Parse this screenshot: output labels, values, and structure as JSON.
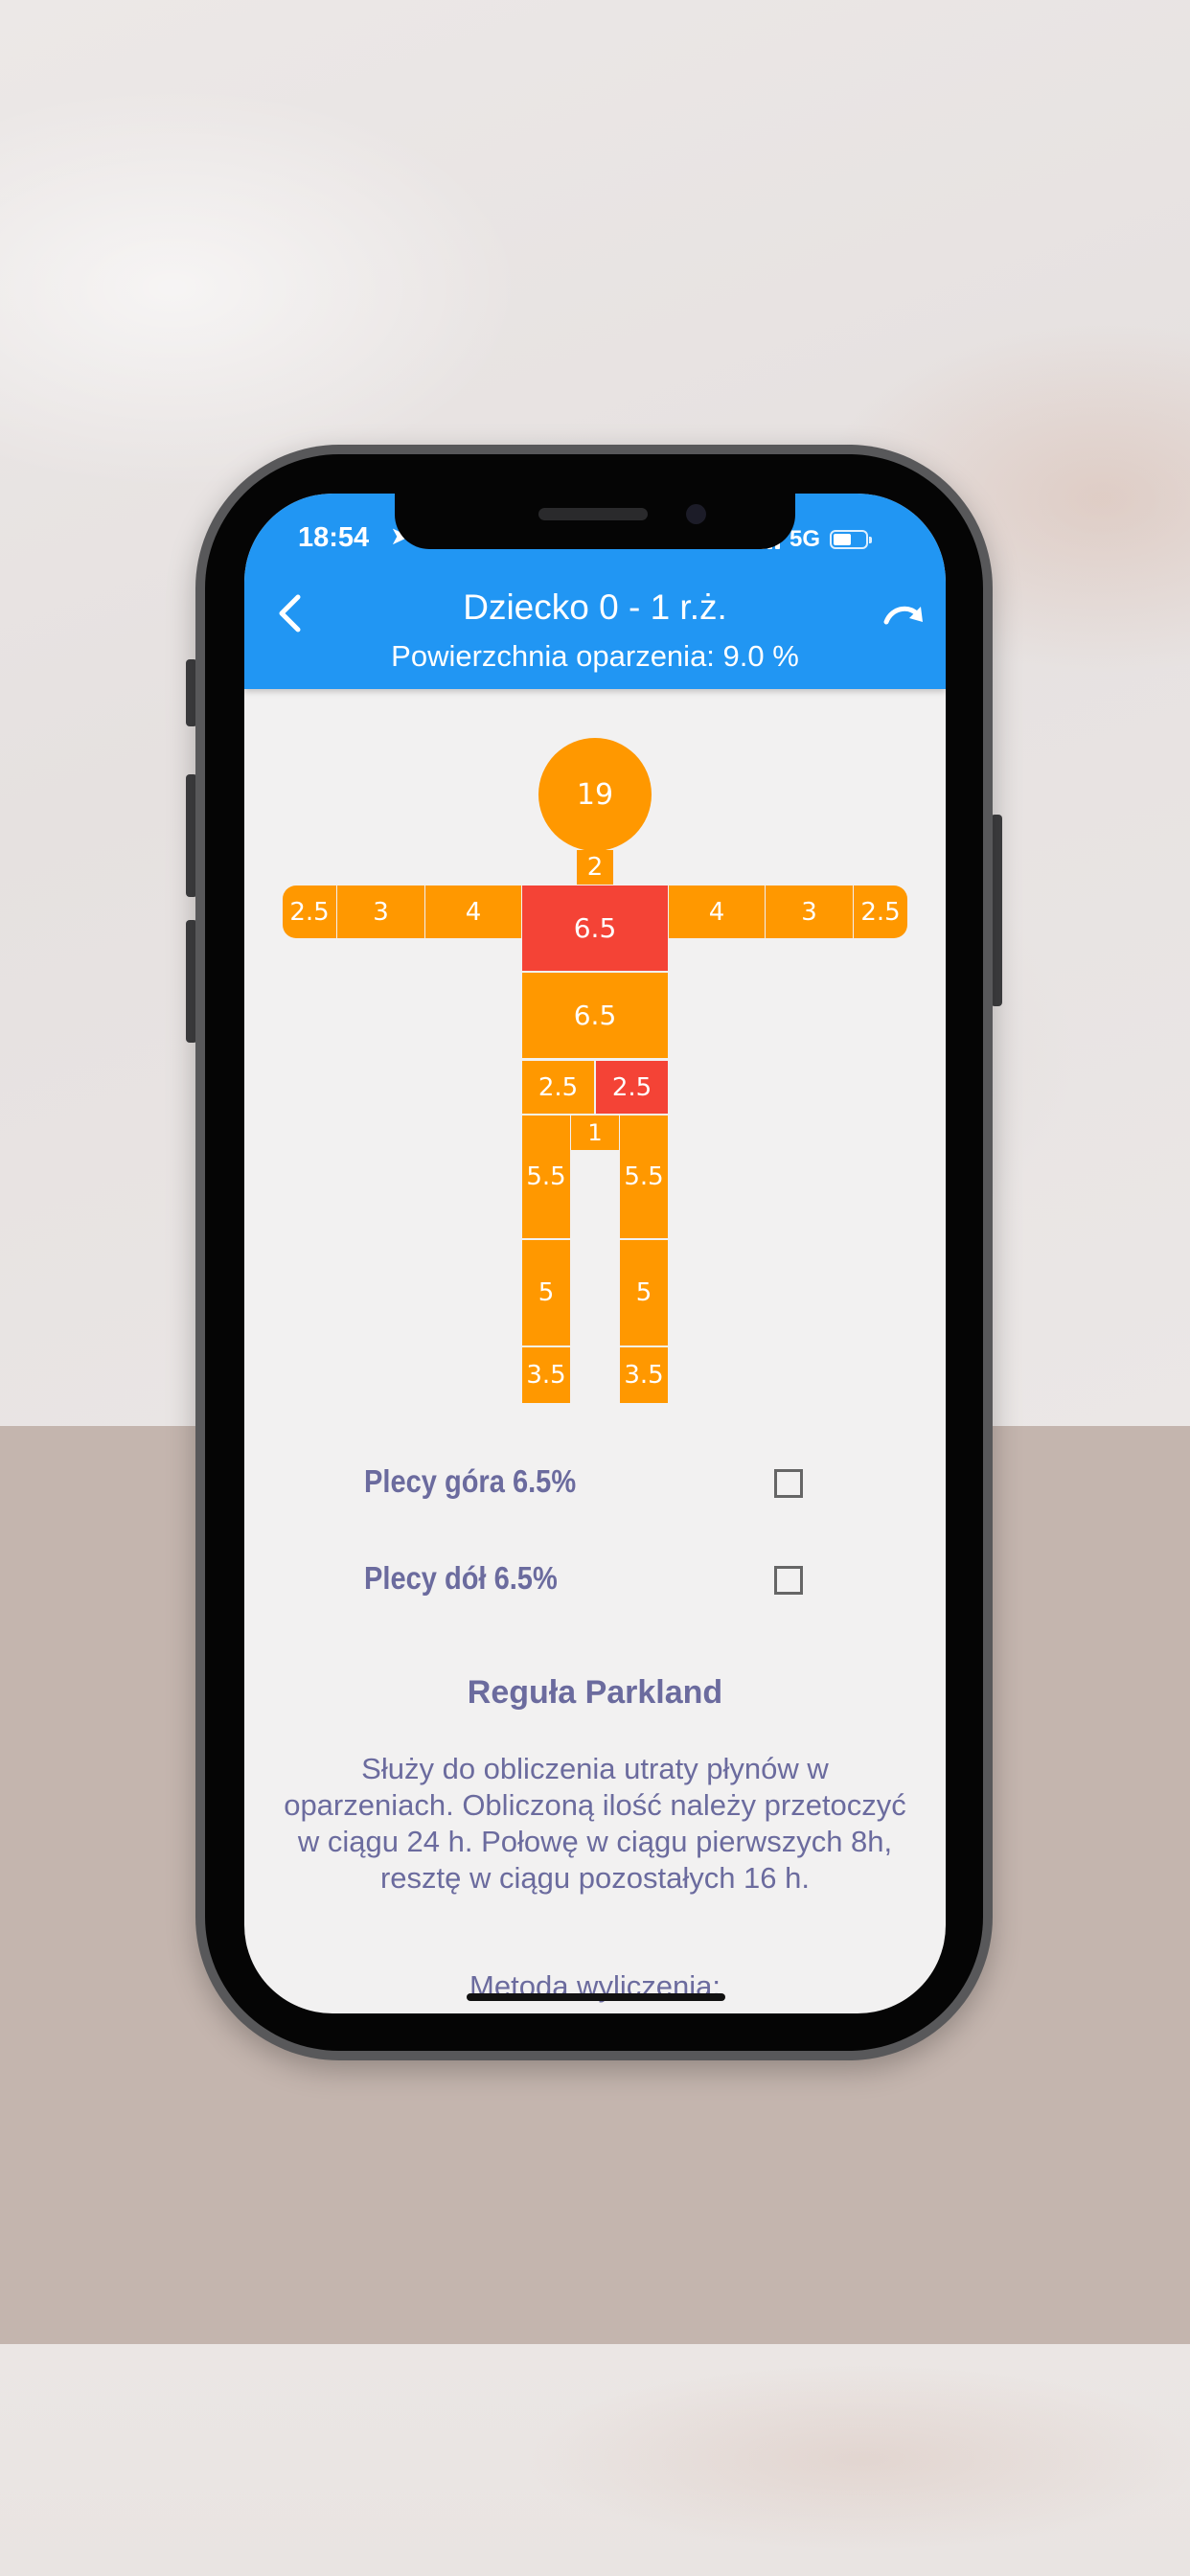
{
  "status_bar": {
    "time": "18:54",
    "network": "5G"
  },
  "header": {
    "title": "Dziecko 0 - 1 r.ż.",
    "subtitle": "Powierzchnia oparzenia: 9.0 %"
  },
  "body_map": {
    "head": "19",
    "neck": "2",
    "right_hand": "2.5",
    "right_forearm": "3",
    "right_upper_arm": "4",
    "chest": "6.5",
    "left_upper_arm": "4",
    "left_forearm": "3",
    "left_hand": "2.5",
    "abdomen": "6.5",
    "right_buttock": "2.5",
    "left_buttock": "2.5",
    "genitals": "1",
    "right_thigh": "5.5",
    "left_thigh": "5.5",
    "right_lower_leg": "5",
    "left_lower_leg": "5",
    "right_foot": "3.5",
    "left_foot": "3.5",
    "colors": {
      "unselected": "#ff9800",
      "selected": "#f44336"
    }
  },
  "back_options": {
    "upper_back": "Plecy góra 6.5%",
    "lower_back": "Plecy dół 6.5%"
  },
  "parkland": {
    "title": "Reguła Parkland",
    "description": "Służy do obliczenia utraty płynów w oparzeniach. Obliczoną ilość należy przetoczyć w ciągu 24 h. Połowę w ciągu pierwszych 8h, resztę w ciągu pozostałych 16 h.",
    "method_label": "Metoda wyliczenia:"
  }
}
